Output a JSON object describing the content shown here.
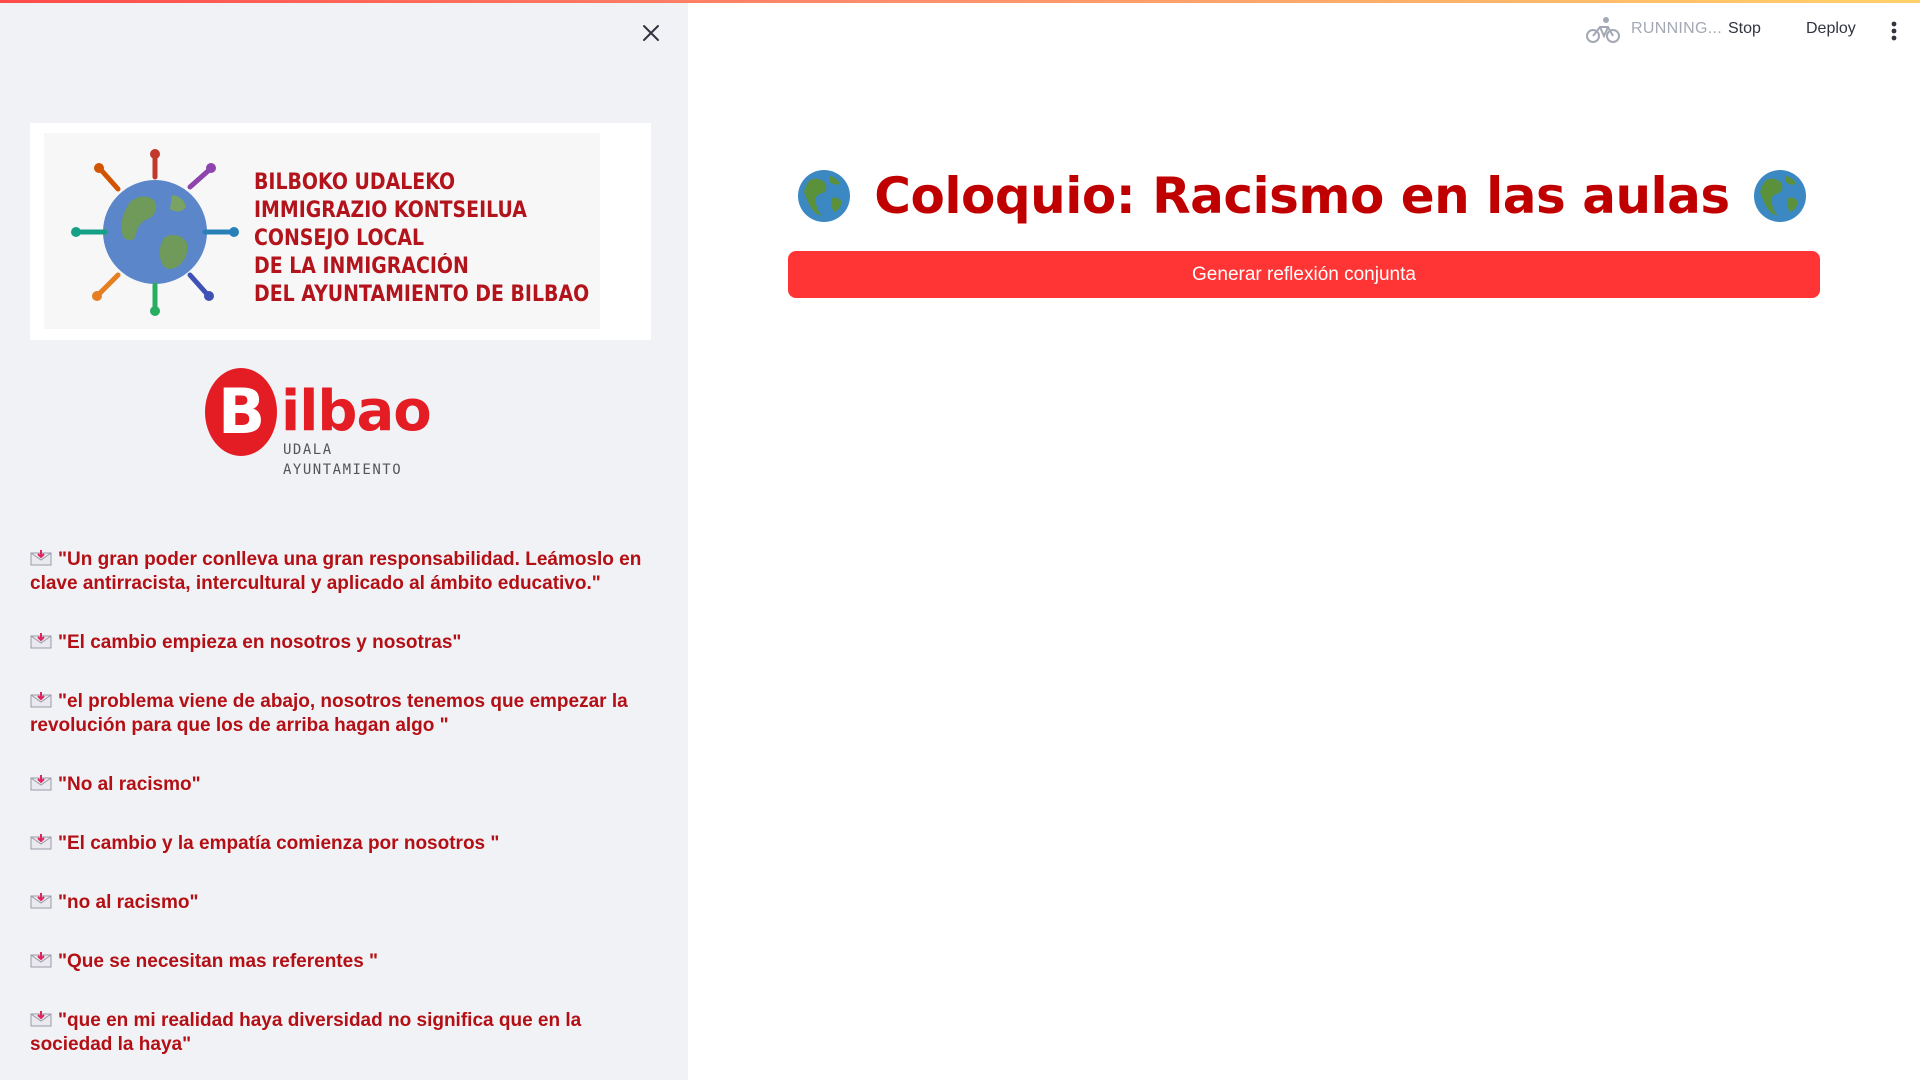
{
  "toolbar": {
    "status": "RUNNING...",
    "stop_label": "Stop",
    "deploy_label": "Deploy",
    "running_icon": "bicycle-icon",
    "menu_icon": "vertical-dots-icon"
  },
  "sidebar": {
    "close_icon": "close-icon",
    "council_logo": {
      "lines": [
        "BILBOKO UDALEKO",
        "IMMIGRAZIO KONTSEILUA",
        "CONSEJO LOCAL",
        "DE LA INMIGRACIÓN",
        "DEL AYUNTAMIENTO DE BILBAO"
      ]
    },
    "city_logo": {
      "initial": "B",
      "rest": "ilbao",
      "sub1": "UDALA",
      "sub2": "AYUNTAMIENTO"
    },
    "message_icon": "incoming-envelope-icon",
    "messages": [
      "\"Un gran poder conlleva una gran responsabilidad. Leámoslo en clave antirracista, intercultural y aplicado al ámbito educativo.\"",
      "\"El cambio empieza en nosotros y nosotras\"",
      "\"el problema viene de abajo, nosotros tenemos que empezar la revolución para que los de arriba hagan algo \"",
      "\"No al racismo\"",
      "\"El cambio y la empatía comienza por nosotros \"",
      "\"no al racismo\"",
      "\"Que se necesitan mas referentes \"",
      "\"que en mi realidad haya diversidad no significa que en la sociedad la haya\""
    ]
  },
  "main": {
    "title": "Coloquio: Racismo en las aulas",
    "title_icon": "globe-americas-icon",
    "button_label": "Generar reflexión conjunta"
  },
  "colors": {
    "accent": "#ff3535",
    "title": "#c00000",
    "message_text": "#b30f14",
    "sidebar_bg": "#f0f2f6"
  }
}
